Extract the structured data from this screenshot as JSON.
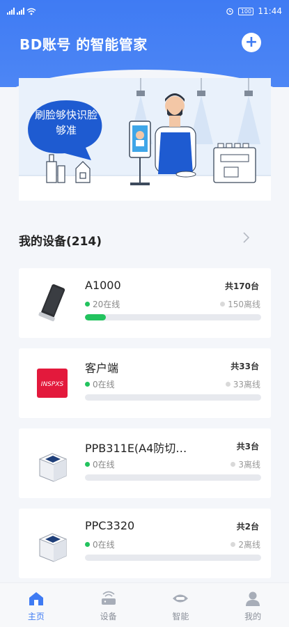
{
  "status_bar": {
    "time": "11:44",
    "battery": "100"
  },
  "header": {
    "title": "BD账号 的智能管家",
    "add_label": "+"
  },
  "banner": {
    "bubble_text": "刷脸够快识脸够准"
  },
  "devices_section": {
    "title": "我的设备(214)"
  },
  "devices": [
    {
      "name": "A1000",
      "total": "共170台",
      "online": "20在线",
      "offline": "150离线",
      "online_fraction": 0.118,
      "thumb": "phone-device"
    },
    {
      "name": "客户端",
      "total": "共33台",
      "online": "0在线",
      "offline": "33离线",
      "online_fraction": 0,
      "thumb": "client-logo"
    },
    {
      "name": "PPB311E(A4防切…",
      "total": "共3台",
      "online": "0在线",
      "offline": "3离线",
      "online_fraction": 0,
      "thumb": "scanner-device"
    },
    {
      "name": "PPC3320",
      "total": "共2台",
      "online": "0在线",
      "offline": "2离线",
      "online_fraction": 0,
      "thumb": "scanner-device"
    }
  ],
  "client_logo_text": "INSPXS",
  "nav": [
    {
      "label": "主页",
      "icon": "home-icon",
      "active": true
    },
    {
      "label": "设备",
      "icon": "router-icon",
      "active": false
    },
    {
      "label": "智能",
      "icon": "eye-icon",
      "active": false
    },
    {
      "label": "我的",
      "icon": "person-icon",
      "active": false
    }
  ],
  "colors": {
    "primary": "#3f7bf3",
    "online": "#22c35e",
    "offline": "#d9d9d9"
  }
}
